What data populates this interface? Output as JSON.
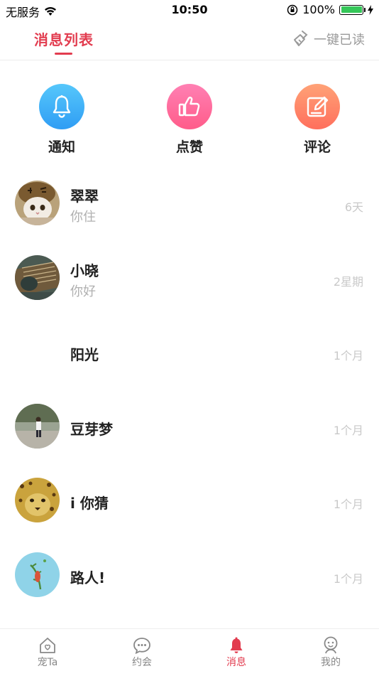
{
  "status_bar": {
    "carrier": "无服务",
    "time": "10:50",
    "battery": "100%",
    "battery_level": 1.0
  },
  "header": {
    "title": "消息列表",
    "read_all": "一键已读"
  },
  "shortcuts": [
    {
      "label": "通知",
      "icon": "bell-icon",
      "color_top": "#56c7fb",
      "color_bottom": "#2f9df4"
    },
    {
      "label": "点赞",
      "icon": "thumb-up-icon",
      "color_top": "#ff80b3",
      "color_bottom": "#ff5c8a"
    },
    {
      "label": "评论",
      "icon": "edit-icon",
      "color_top": "#ffa277",
      "color_bottom": "#ff6f5c"
    }
  ],
  "messages": [
    {
      "name": "翠翠",
      "preview": "你住",
      "time": "6天",
      "avatar": "cat-avatar"
    },
    {
      "name": "小晓",
      "preview": "你好",
      "time": "2星期",
      "avatar": "guitar-avatar"
    },
    {
      "name": "阳光",
      "preview": "",
      "time": "1个月",
      "avatar": "none"
    },
    {
      "name": "豆芽梦",
      "preview": "",
      "time": "1个月",
      "avatar": "person-avatar"
    },
    {
      "name": "i 你猜",
      "preview": "",
      "time": "1个月",
      "avatar": "leopard-avatar"
    },
    {
      "name": "路人!",
      "preview": "",
      "time": "1个月",
      "avatar": "bird-avatar"
    }
  ],
  "tabbar": [
    {
      "label": "宠Ta",
      "icon": "home-icon",
      "active": false
    },
    {
      "label": "约会",
      "icon": "chat-icon",
      "active": false
    },
    {
      "label": "消息",
      "icon": "bell-icon",
      "active": true
    },
    {
      "label": "我的",
      "icon": "profile-icon",
      "active": false
    }
  ],
  "colors": {
    "accent": "#e23c4f",
    "muted": "#9a9a9a"
  }
}
